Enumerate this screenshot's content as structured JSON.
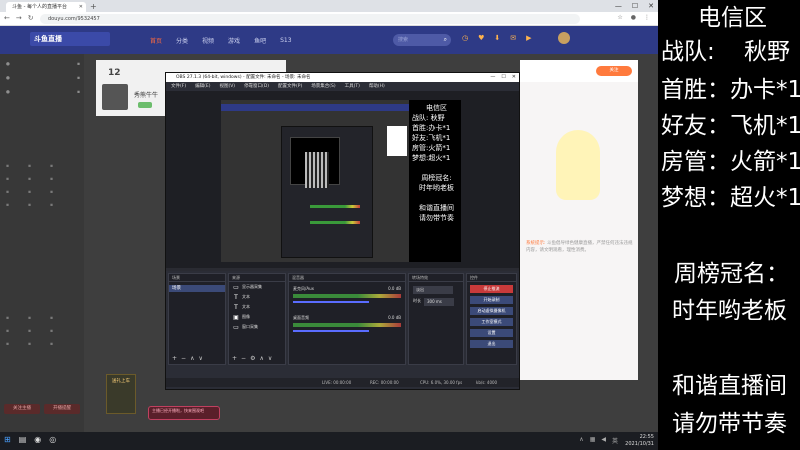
{
  "browser": {
    "tab_title": "斗鱼 - 每个人的直播平台",
    "new_tab": "+",
    "url": "douyu.com/9532457"
  },
  "site": {
    "logo": "斗鱼直播",
    "nav": [
      "首页",
      "分类",
      "视频",
      "游戏",
      "鱼吧",
      "S13"
    ],
    "search_placeholder": "搜索",
    "viewers": "12",
    "room_name": "秀熊牛牛",
    "follow_button": "关注",
    "sidebar_bottom_buttons": [
      "关注主播",
      "开播提醒"
    ],
    "rp_text_lead": "系统提示:",
    "rp_text": "斗鱼倡导绿色健康直播，严禁任何违法违规内容，请文明观看，理性消费。",
    "gift_label": "送礼上车",
    "toast_text": "主播已经开播啦，快来围观吧"
  },
  "obs": {
    "title": "OBS 27.1.3 (64-bit, windows) - 配置文件: 未命名 - 场景: 未命名",
    "menu": [
      "文件(F)",
      "编辑(E)",
      "视图(V)",
      "停靠窗口(D)",
      "配置文件(P)",
      "场景集合(S)",
      "工具(T)",
      "帮助(H)"
    ],
    "panels": {
      "scenes": "场景",
      "sources": "来源",
      "mixer": "混音器",
      "transitions": "转场特效",
      "controls": "控件"
    },
    "scene_name": "场景",
    "sources_list": [
      {
        "icon": "▭",
        "name": "显示器采集"
      },
      {
        "icon": "T",
        "name": "文本"
      },
      {
        "icon": "T",
        "name": "文本"
      },
      {
        "icon": "▣",
        "name": "图像"
      },
      {
        "icon": "▭",
        "name": "窗口采集"
      }
    ],
    "mixer": [
      {
        "name": "桌面音频",
        "db": "0.0 dB"
      },
      {
        "name": "麦克风/Aux",
        "db": "0.0 dB"
      }
    ],
    "transition": "淡出",
    "duration_label": "时长",
    "duration": "300 ms",
    "controls": [
      "停止推流",
      "开始录制",
      "启动虚拟摄像机",
      "工作室模式",
      "设置",
      "退出"
    ],
    "status": {
      "live": "LIVE: 00:00:00",
      "rec": "REC: 00:00:00",
      "cpu": "CPU: 6.0%, 30.00 fps",
      "kbps": "kb/s: 4000"
    }
  },
  "taskbar": {
    "time": "22:55",
    "date": "2021/10/31"
  },
  "overlay": {
    "line1": "电信区",
    "line2_label": "战队:",
    "line2_value": "秋野",
    "line3": "首胜：办卡*1",
    "line4": "好友：飞机*1",
    "line5": "房管：火箭*1",
    "line6": "梦想：超火*1",
    "line7": "周榜冠名：",
    "line8": "时年哟老板",
    "line9": "和谐直播间",
    "line10": "请勿带节奏"
  },
  "mini_overlay": {
    "lines": [
      "电信区",
      "战队: 秋野",
      "首胜:办卡*1",
      "好友:飞机*1",
      "房管:火箭*1",
      "梦想:超火*1"
    ],
    "rank_lines": [
      "周榜冠名:",
      "时年哟老板"
    ],
    "footer_lines": [
      "和谐直播间",
      "请勿带节奏"
    ]
  },
  "icons": {
    "search": "search-icon",
    "close": "close-icon",
    "minimize": "minimize-icon",
    "maximize": "maximize-icon",
    "windows": "windows-icon"
  },
  "colors": {
    "douyu_header": "#2e3a86",
    "accent_orange": "#ff7a3d",
    "obs_stop_stream": "#c83a3a"
  }
}
